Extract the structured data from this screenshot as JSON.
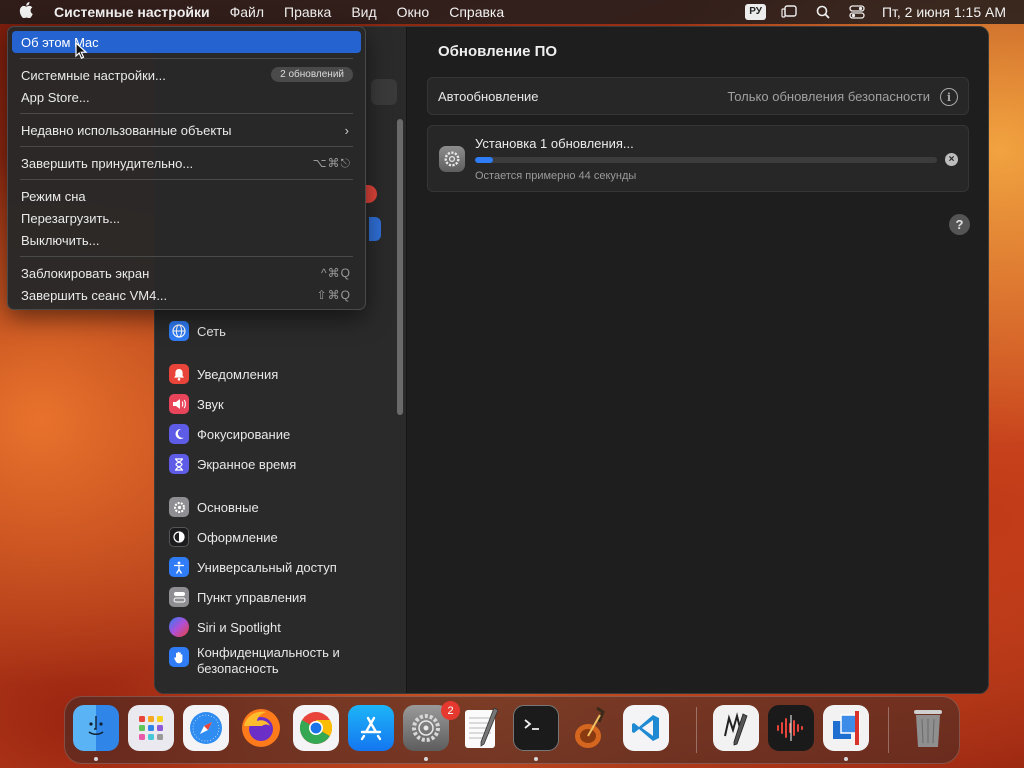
{
  "menubar": {
    "app_name": "Системные настройки",
    "items": [
      "Файл",
      "Правка",
      "Вид",
      "Окно",
      "Справка"
    ],
    "input_source": "РУ",
    "clock": "Пт, 2 июня  1:15 AM"
  },
  "apple_menu": {
    "about": "Об этом Mac",
    "system_settings": "Системные настройки...",
    "updates_badge": "2 обновлений",
    "app_store": "App Store...",
    "recent_items": "Недавно использованные объекты",
    "force_quit": "Завершить принудительно...",
    "force_quit_shortcut": "⌥⌘⎋",
    "sleep": "Режим сна",
    "restart": "Перезагрузить...",
    "shutdown": "Выключить...",
    "lock_screen": "Заблокировать экран",
    "lock_shortcut": "^⌘Q",
    "logout": "Завершить сеанс VM4...",
    "logout_shortcut": "⇧⌘Q"
  },
  "sidebar": {
    "items": [
      {
        "label": "Сеть",
        "color": "#2f7cf6"
      },
      {
        "label": "Уведомления",
        "color": "#e8443a"
      },
      {
        "label": "Звук",
        "color": "#e8445a"
      },
      {
        "label": "Фокусирование",
        "color": "#5e5ce6"
      },
      {
        "label": "Экранное время",
        "color": "#5e5ce6"
      },
      {
        "label": "Основные",
        "color": "#8e8e93"
      },
      {
        "label": "Оформление",
        "color": "#1c1c1e"
      },
      {
        "label": "Универсальный доступ",
        "color": "#2f7cf6"
      },
      {
        "label": "Пункт управления",
        "color": "#8e8e93"
      },
      {
        "label": "Siri и Spotlight",
        "color": "#b04fd6"
      },
      {
        "label": "Конфиденциальность и безопасность",
        "color": "#2f7cf6"
      }
    ]
  },
  "content": {
    "title": "Обновление ПО",
    "auto_update_label": "Автообновление",
    "auto_update_value": "Только обновления безопасности",
    "update_title": "Установка 1 обновления...",
    "update_remaining": "Остается примерно 44 секунды",
    "progress_percent": 4
  },
  "dock": {
    "settings_badge": "2",
    "apps": [
      "finder",
      "launchpad",
      "safari",
      "firefox",
      "chrome",
      "app-store",
      "system-settings",
      "textedit",
      "terminal",
      "garageband",
      "vscode",
      "script-editor",
      "voice-memos",
      "archive-utility",
      "trash"
    ]
  }
}
